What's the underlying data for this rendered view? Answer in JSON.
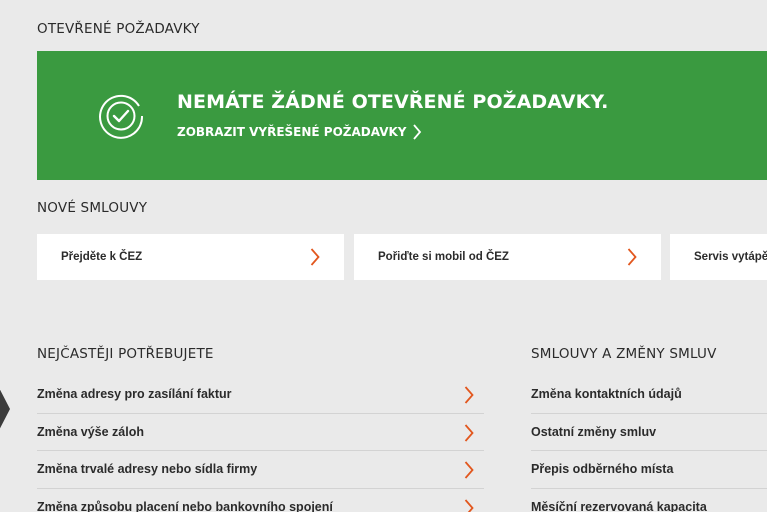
{
  "open_requests": {
    "heading": "OTEVŘENÉ POŽADAVKY",
    "banner_title": "NEMÁTE ŽÁDNÉ OTEVŘENÉ POŽADAVKY.",
    "banner_link": "ZOBRAZIT VYŘEŠENÉ POŽADAVKY",
    "banner_color": "#3a9a40",
    "icon": "check-circle-icon"
  },
  "new_contracts": {
    "heading": "NOVÉ SMLOUVY",
    "cards": [
      {
        "label": "Přejděte k ČEZ"
      },
      {
        "label": "Pořiďte si mobil od ČEZ"
      },
      {
        "label": "Servis vytápění"
      }
    ]
  },
  "frequent": {
    "heading": "NEJČASTĚJI POTŘEBUJETE",
    "items": [
      {
        "label": "Změna adresy pro zasílání faktur"
      },
      {
        "label": "Změna výše záloh"
      },
      {
        "label": "Změna trvalé adresy nebo sídla firmy"
      },
      {
        "label": "Změna způsobu placení nebo bankovního spojení"
      }
    ]
  },
  "contracts_changes": {
    "heading": "SMLOUVY A ZMĚNY SMLUV",
    "items": [
      {
        "label": "Změna kontaktních údajů"
      },
      {
        "label": "Ostatní změny smluv"
      },
      {
        "label": "Přepis odběrného místa"
      },
      {
        "label": "Měsíční rezervovaná kapacita"
      }
    ]
  },
  "accent_color": "#e2571e"
}
